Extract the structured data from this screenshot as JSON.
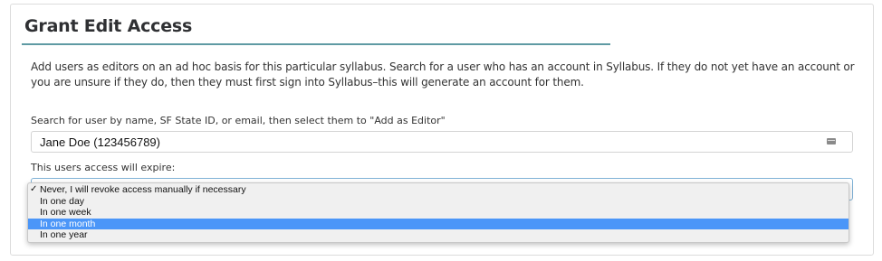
{
  "section": {
    "title": "Grant Edit Access",
    "description": "Add users as editors on an ad hoc basis for this particular syllabus. Search for a user who has an account in Syllabus. If they do not yet have an account or you are unsure if they do, then they must first sign into Syllabus–this will generate an account for them."
  },
  "search": {
    "label": "Search for user by name, SF State ID, or email, then select them to \"Add as Editor\"",
    "value": "Jane Doe (123456789)",
    "icon": "id-card-icon"
  },
  "expire": {
    "label": "This users access will expire:",
    "checkmark": "✓",
    "options": [
      "Never, I will revoke access manually if necessary",
      "In one day",
      "In one week",
      "In one month",
      "In one year"
    ],
    "selected_index": 0,
    "highlighted_index": 3
  },
  "colors": {
    "accent_rule": "#5f9aa3",
    "highlight": "#4b96f8"
  }
}
